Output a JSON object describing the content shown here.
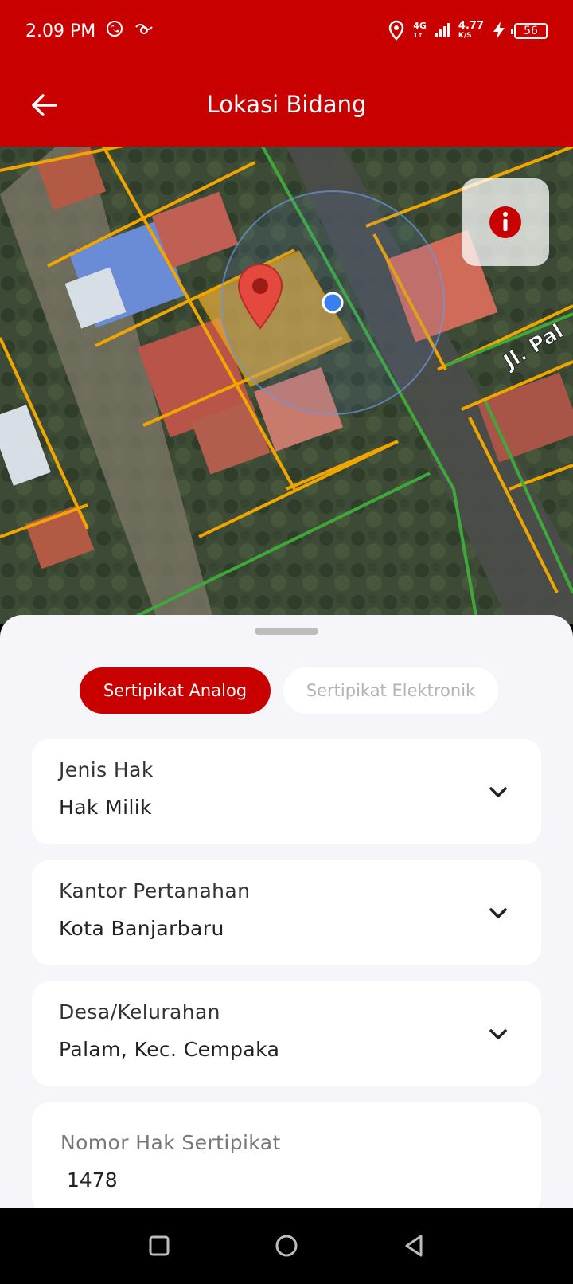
{
  "status_bar": {
    "time": "2.09 PM",
    "network": "4G",
    "network_sub": "1↑",
    "speed": "4.77",
    "speed_unit": "K/S",
    "battery": "56"
  },
  "app_bar": {
    "title": "Lokasi Bidang"
  },
  "map": {
    "road_label": "Jl. Pal"
  },
  "sheet": {
    "tabs": [
      {
        "label": "Sertipikat Analog",
        "active": true
      },
      {
        "label": "Sertipikat Elektronik",
        "active": false
      }
    ],
    "fields": [
      {
        "label": "Jenis Hak",
        "value": "Hak Milik"
      },
      {
        "label": "Kantor Pertanahan",
        "value": "Kota Banjarbaru"
      },
      {
        "label": "Desa/Kelurahan",
        "value": "Palam, Kec. Cempaka"
      }
    ],
    "nomor_hak": {
      "label": "Nomor Hak Sertipikat",
      "value": "1478"
    }
  },
  "colors": {
    "brand": "#C80000",
    "sheet_bg": "#F6F6FA",
    "parcel_border": "#F0A500",
    "road_line": "#3FA83A"
  }
}
